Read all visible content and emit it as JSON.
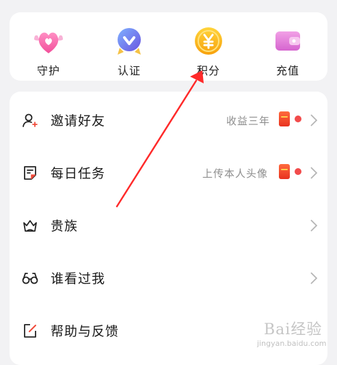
{
  "shortcuts": [
    {
      "label": "守护",
      "icon": "heart-wings-icon"
    },
    {
      "label": "认证",
      "icon": "verified-badge-icon"
    },
    {
      "label": "积分",
      "icon": "yuan-coin-icon"
    },
    {
      "label": "充值",
      "icon": "wallet-icon"
    }
  ],
  "menu": [
    {
      "label": "邀请好友",
      "hint": "收益三年",
      "icon": "invite-user-icon",
      "has_red_packet": true
    },
    {
      "label": "每日任务",
      "hint": "上传本人头像",
      "icon": "task-note-icon",
      "has_red_packet": true
    },
    {
      "label": "贵族",
      "hint": "",
      "icon": "crown-icon",
      "has_red_packet": false
    },
    {
      "label": "谁看过我",
      "hint": "",
      "icon": "glasses-icon",
      "has_red_packet": false
    },
    {
      "label": "帮助与反馈",
      "hint": "",
      "icon": "feedback-edit-icon",
      "has_red_packet": false
    }
  ],
  "watermark": {
    "main": "Bai经验",
    "sub": "jingyan.baidu.com"
  },
  "colors": {
    "arrow": "#ff2a2a",
    "badge_dot": "#f24b4b",
    "coin": "#f7b414",
    "wallet": "#e57bd8"
  }
}
